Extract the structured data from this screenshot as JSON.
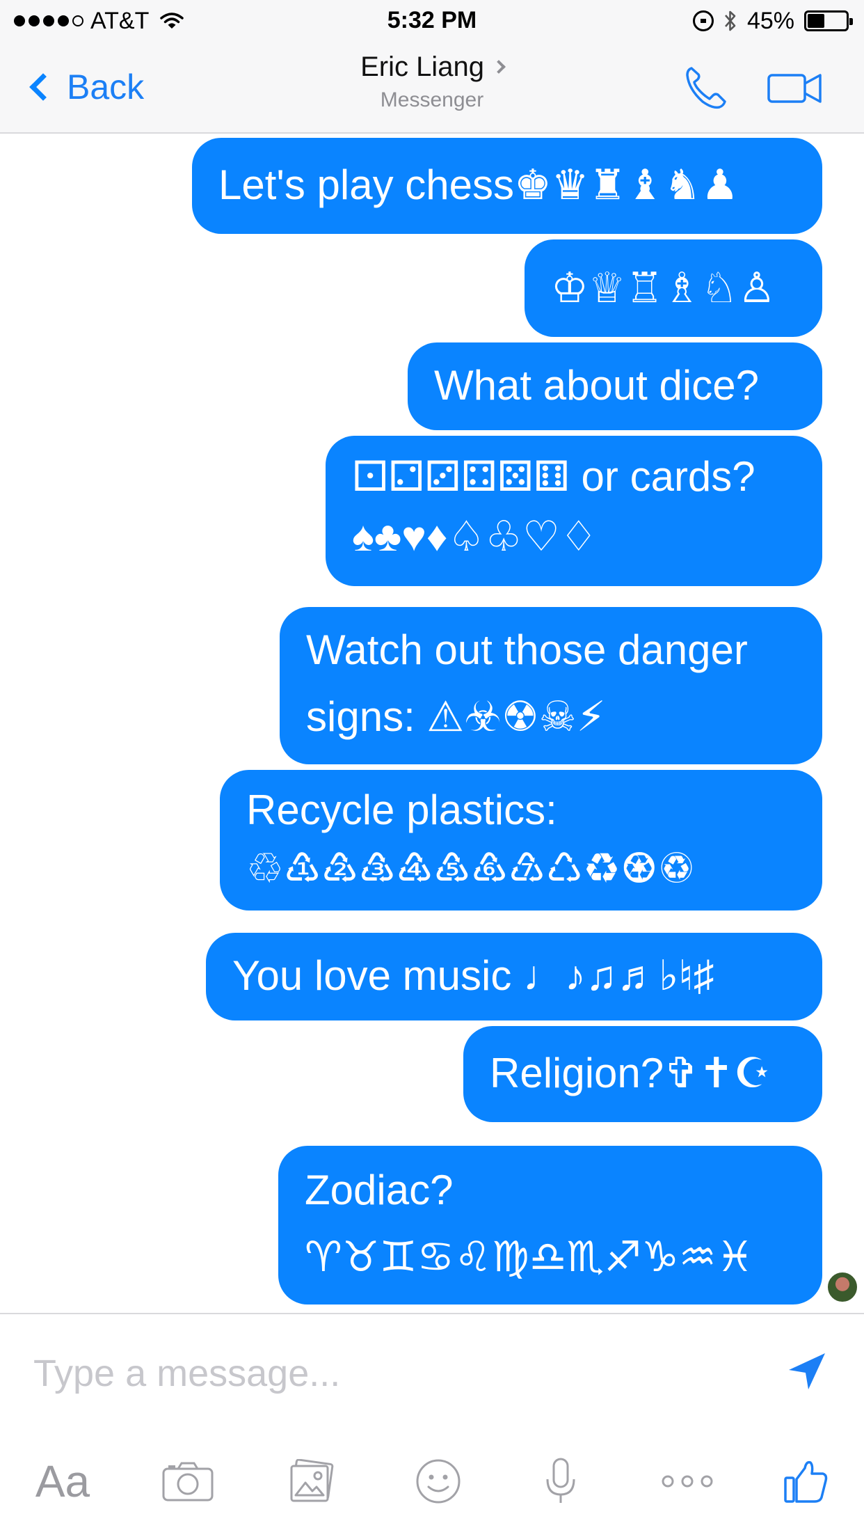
{
  "status_bar": {
    "carrier": "AT&T",
    "time": "5:32 PM",
    "battery_percent": "45%",
    "battery_level": 0.45,
    "signal_bars": 4,
    "signal_total": 5
  },
  "nav": {
    "back_label": "Back",
    "title": "Eric Liang",
    "subtitle": "Messenger",
    "icons": [
      "back-chevron-icon",
      "phone-icon",
      "video-camera-icon"
    ]
  },
  "messages": [
    {
      "lines": [
        "Let's play chess♚♛♜♝♞♟"
      ]
    },
    {
      "lines": [
        "♔♕♖♗♘♙"
      ]
    },
    {
      "lines": [
        "What about dice?"
      ]
    },
    {
      "lines": [
        "⚀⚁⚂⚃⚄⚅ or cards?",
        "♠♣♥♦♤♧♡♢"
      ]
    },
    {
      "lines": [
        "Watch out those danger",
        "signs: ⚠☣☢☠⚡"
      ]
    },
    {
      "lines": [
        "Recycle plastics:",
        "♲♳♴♵♶♷♸♹♺♻♼♽"
      ]
    },
    {
      "lines": [
        "You love music ♩♪♫♬♭♮♯"
      ]
    },
    {
      "lines": [
        "Religion?✞✝☪"
      ]
    },
    {
      "lines": [
        "Zodiac?",
        "♈♉♊♋♌♍♎♏♐♑♒♓"
      ]
    }
  ],
  "composer": {
    "placeholder": "Type a message...",
    "aa_label": "Aa",
    "icons": [
      "send-icon",
      "text-format-icon",
      "camera-icon",
      "photo-gallery-icon",
      "emoji-icon",
      "microphone-icon",
      "more-icon",
      "thumbs-up-icon"
    ]
  },
  "colors": {
    "accent": "#0a84ff",
    "bar_background": "#f7f7f8",
    "toolbar_icon": "#a2a2a7",
    "placeholder": "#c7c7cc"
  }
}
